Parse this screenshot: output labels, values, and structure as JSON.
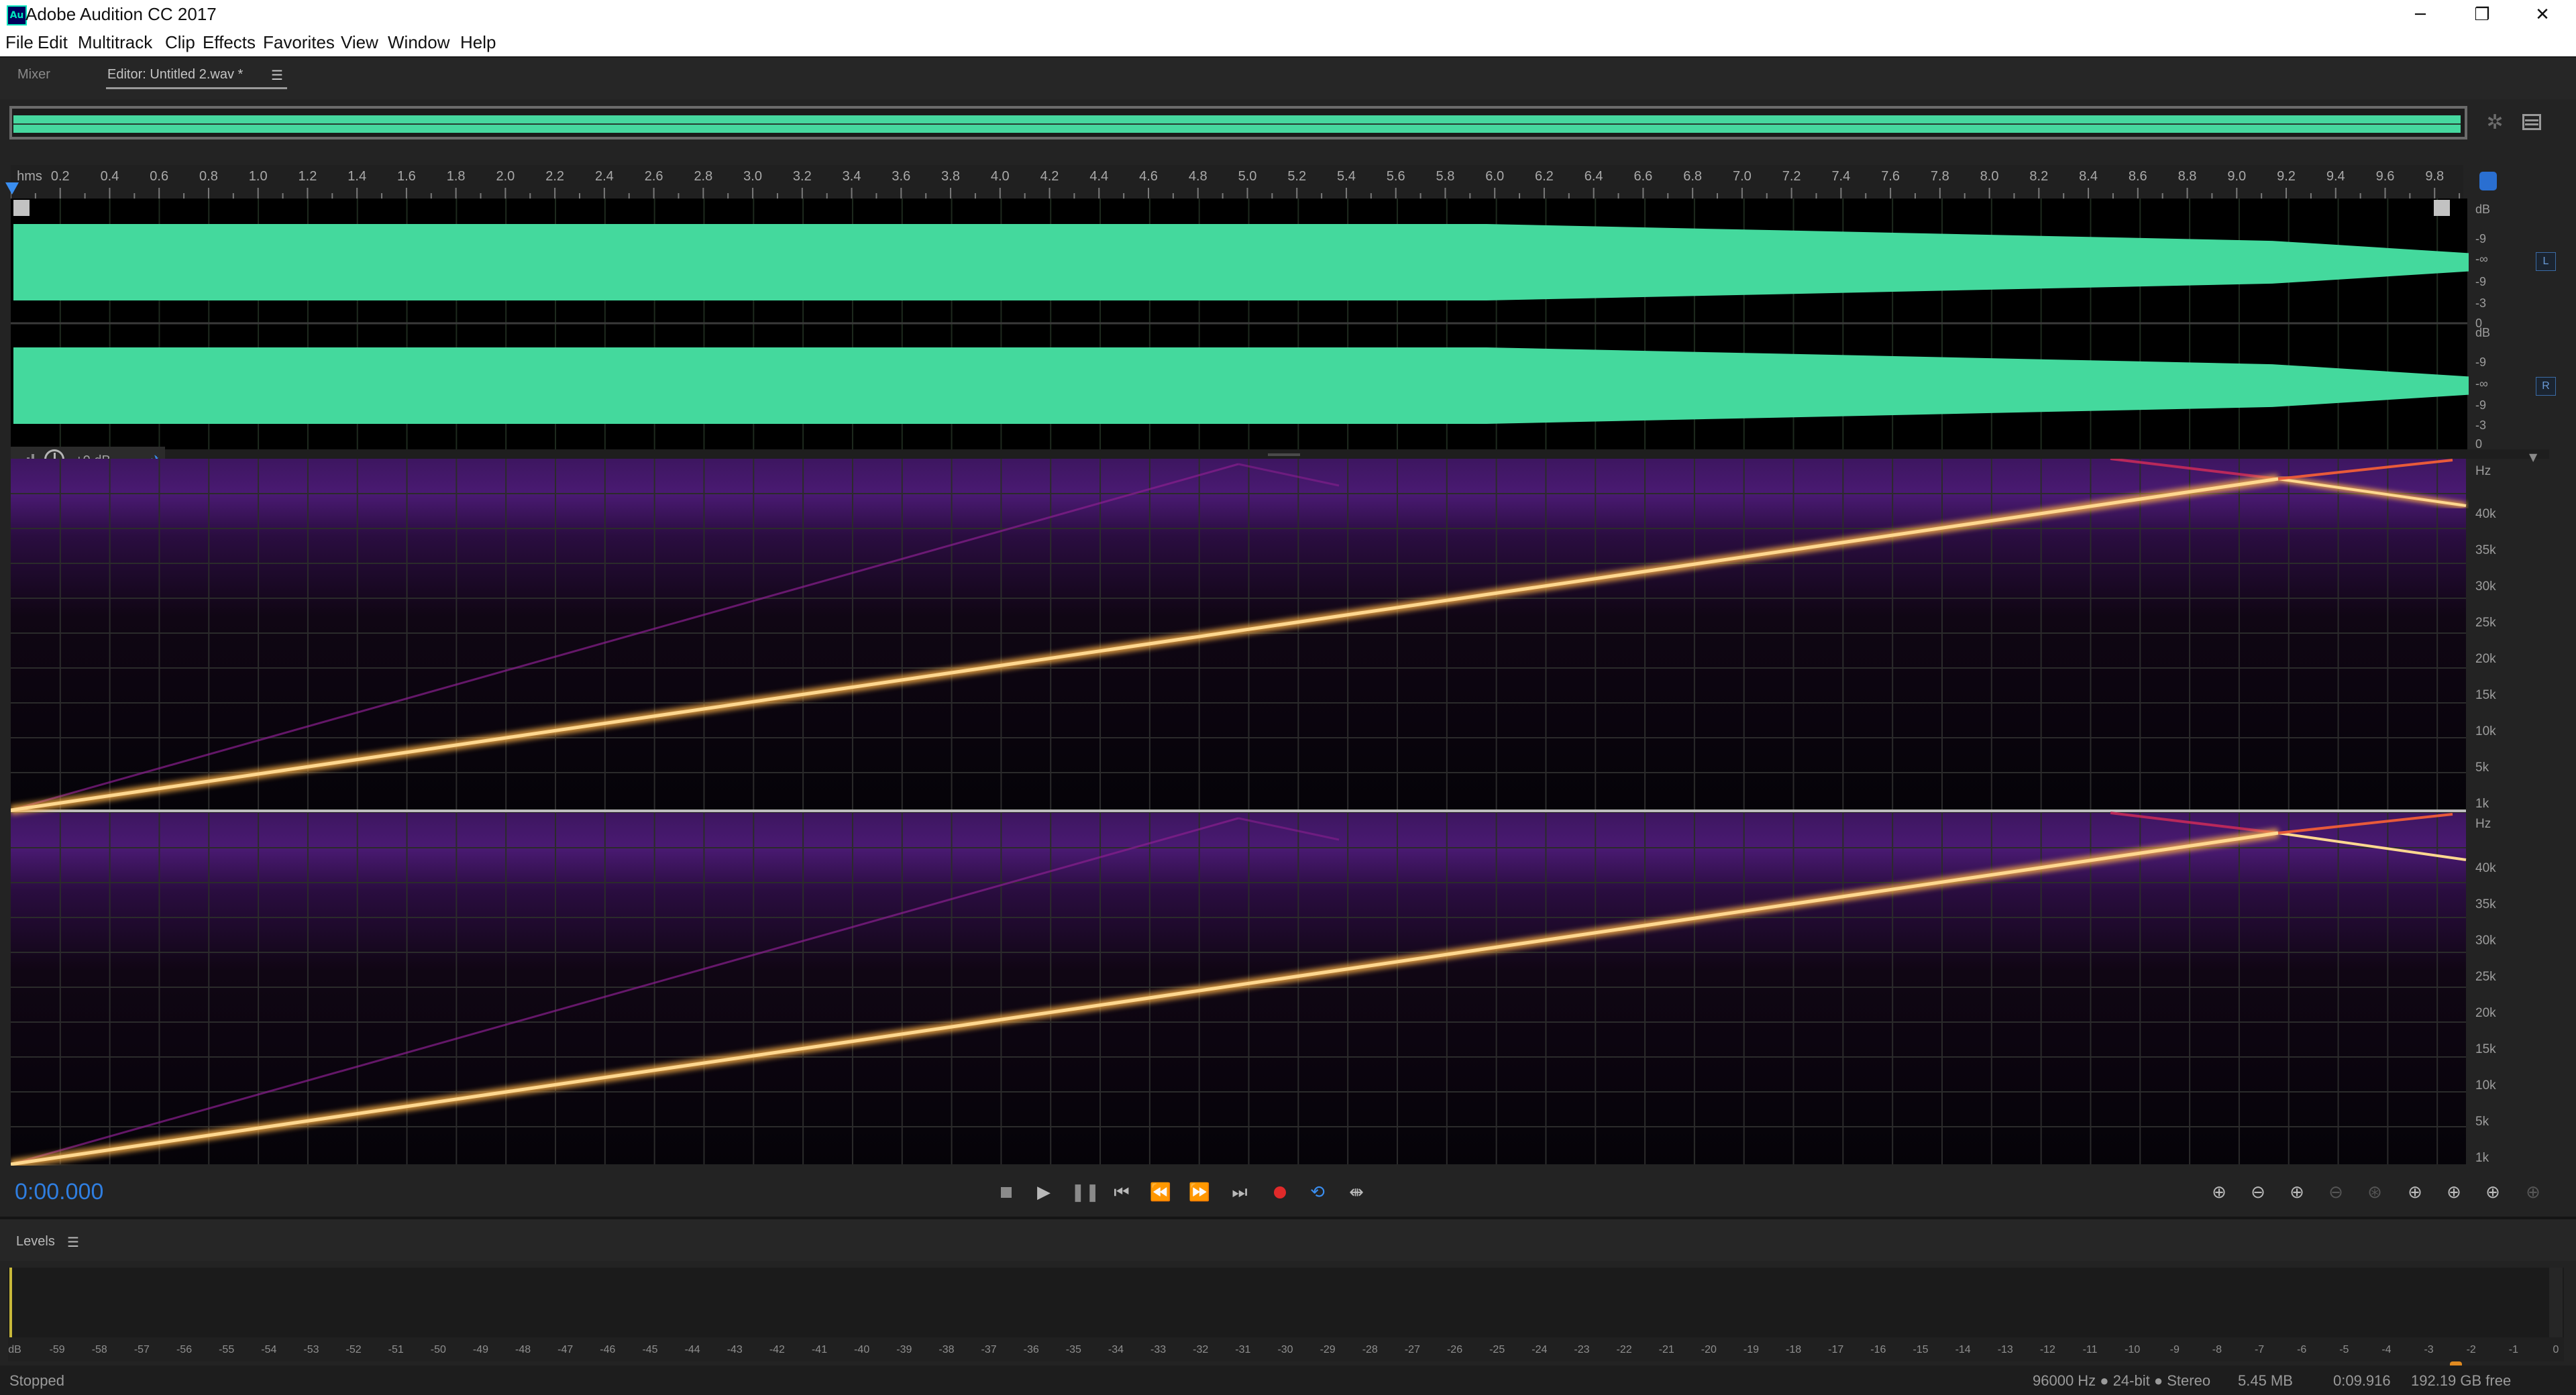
{
  "window": {
    "title": "Adobe Audition CC 2017",
    "app_icon_text": "Au",
    "buttons": {
      "minimize": "─",
      "maximize": "❐",
      "close": "✕"
    }
  },
  "menu": [
    "File",
    "Edit",
    "Multitrack",
    "Clip",
    "Effects",
    "Favorites",
    "View",
    "Window",
    "Help"
  ],
  "tabs": {
    "mixer": "Mixer",
    "editor": "Editor: Untitled 2.wav *",
    "editor_menu_icon": "☰"
  },
  "ruler": {
    "unit": "hms",
    "ticks": [
      "0.2",
      "0.4",
      "0.6",
      "0.8",
      "1.0",
      "1.2",
      "1.4",
      "1.6",
      "1.8",
      "2.0",
      "2.2",
      "2.4",
      "2.6",
      "2.8",
      "3.0",
      "3.2",
      "3.4",
      "3.6",
      "3.8",
      "4.0",
      "4.2",
      "4.4",
      "4.6",
      "4.8",
      "5.0",
      "5.2",
      "5.4",
      "5.6",
      "5.8",
      "6.0",
      "6.2",
      "6.4",
      "6.6",
      "6.8",
      "7.0",
      "7.2",
      "7.4",
      "7.6",
      "7.8",
      "8.0",
      "8.2",
      "8.4",
      "8.6",
      "8.8",
      "9.0",
      "9.2",
      "9.4",
      "9.6",
      "9.8"
    ]
  },
  "waveform": {
    "color": "#44d99d",
    "db_scale": [
      "dB",
      "-9",
      "-∞",
      "-9",
      "-3",
      "0"
    ],
    "channels": [
      "L",
      "R"
    ]
  },
  "hud": {
    "gain": "+0 dB"
  },
  "spectral": {
    "hz_label": "Hz",
    "freq_labels": [
      "40k",
      "35k",
      "30k",
      "25k",
      "20k",
      "15k",
      "10k",
      "5k",
      "1k"
    ]
  },
  "transport": {
    "time": "0:00.000",
    "buttons": [
      "stop",
      "play",
      "pause",
      "go-to-start",
      "rewind",
      "fast-forward",
      "go-to-end",
      "record",
      "loop",
      "skip-selection"
    ]
  },
  "levels": {
    "title": "Levels",
    "menu_icon": "☰",
    "scale": [
      "dB",
      "-59",
      "-58",
      "-57",
      "-56",
      "-55",
      "-54",
      "-53",
      "-52",
      "-51",
      "-50",
      "-49",
      "-48",
      "-47",
      "-46",
      "-45",
      "-44",
      "-43",
      "-42",
      "-41",
      "-40",
      "-39",
      "-38",
      "-37",
      "-36",
      "-35",
      "-34",
      "-33",
      "-32",
      "-31",
      "-30",
      "-29",
      "-28",
      "-27",
      "-26",
      "-25",
      "-24",
      "-23",
      "-22",
      "-21",
      "-20",
      "-19",
      "-18",
      "-17",
      "-16",
      "-15",
      "-14",
      "-13",
      "-12",
      "-11",
      "-10",
      "-9",
      "-8",
      "-7",
      "-6",
      "-5",
      "-4",
      "-3",
      "-2",
      "-1",
      "0"
    ]
  },
  "status": {
    "state": "Stopped",
    "format": "96000 Hz ● 24-bit ● Stereo",
    "size": "5.45 MB",
    "duration": "0:09.916",
    "free": "192.19 GB free"
  }
}
